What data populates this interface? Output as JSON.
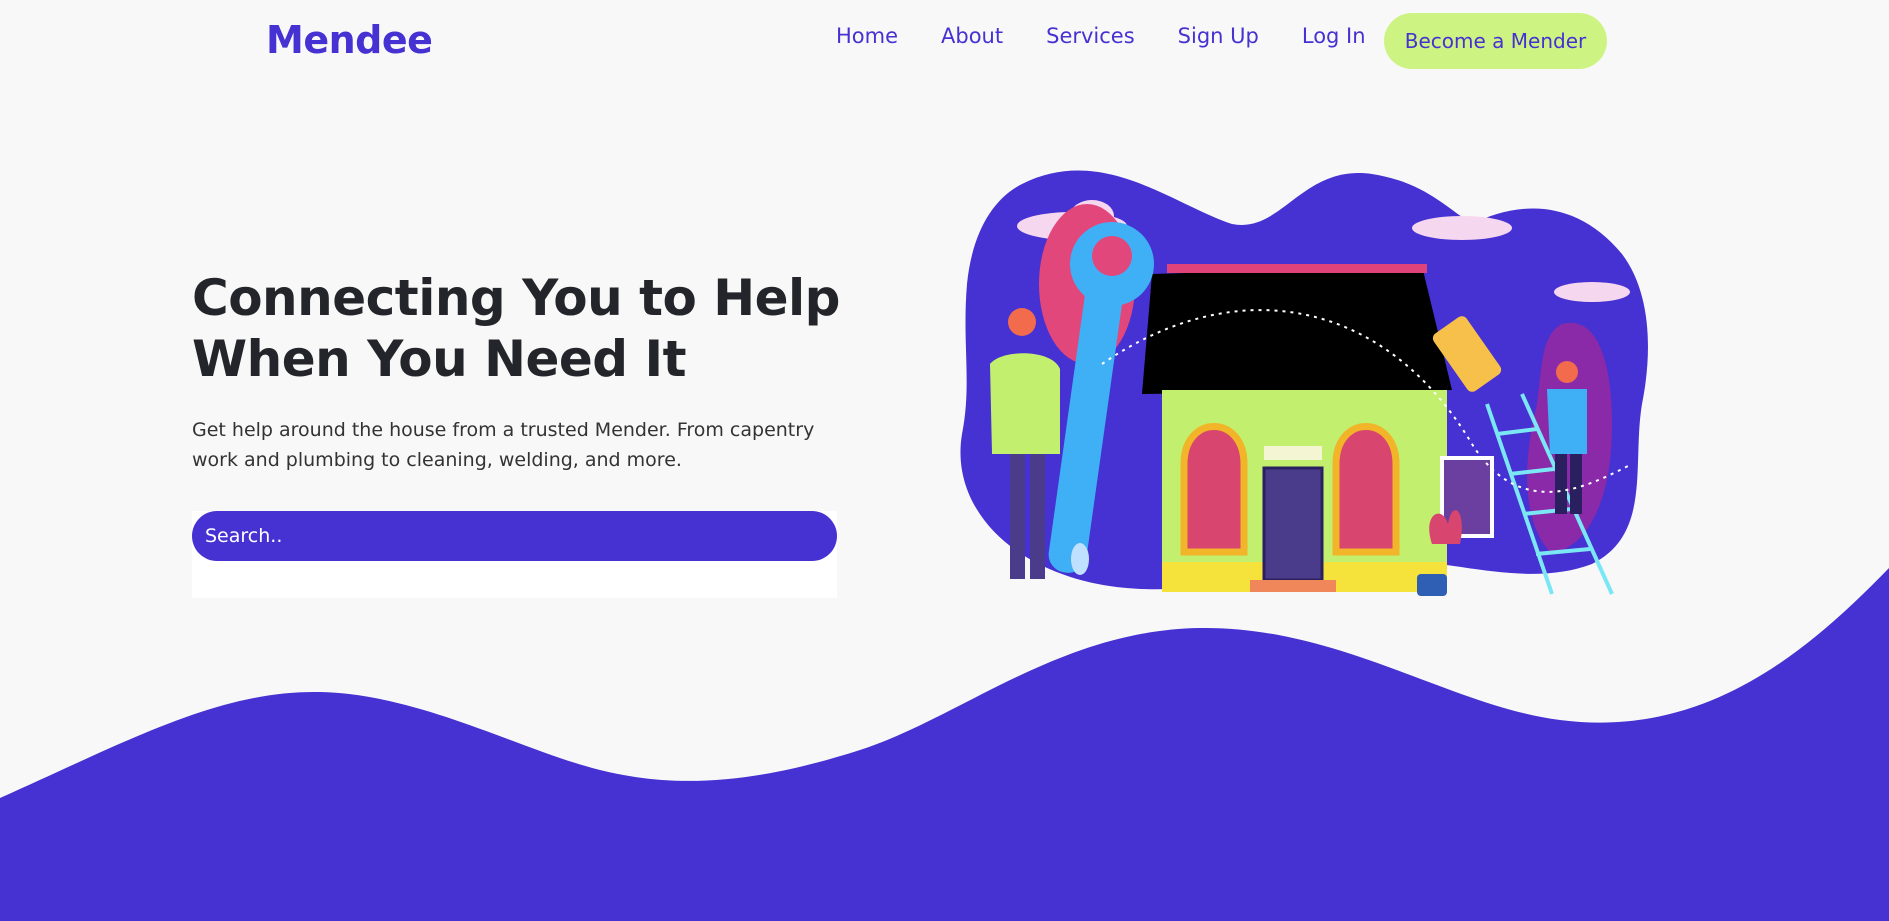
{
  "nav": {
    "logo": "Mendee",
    "links": [
      "Home",
      "About",
      "Services",
      "Sign Up",
      "Log In"
    ],
    "cta_label": "Become a Mender"
  },
  "hero": {
    "title": "Connecting You to Help When You Need It",
    "subtitle": "Get help around the house from a trusted Mender. From capentry work and plumbing to cleaning, welding, and more.",
    "search_placeholder": "Search.."
  },
  "colors": {
    "brand": "#4631d2",
    "accent": "#cdf382",
    "background": "#f8f8f8",
    "heading": "#24252a"
  },
  "illustration": {
    "icons": [
      "house-illustration",
      "wrench-icon",
      "paint-roller-icon",
      "ladder-icon",
      "plant-icon"
    ]
  }
}
